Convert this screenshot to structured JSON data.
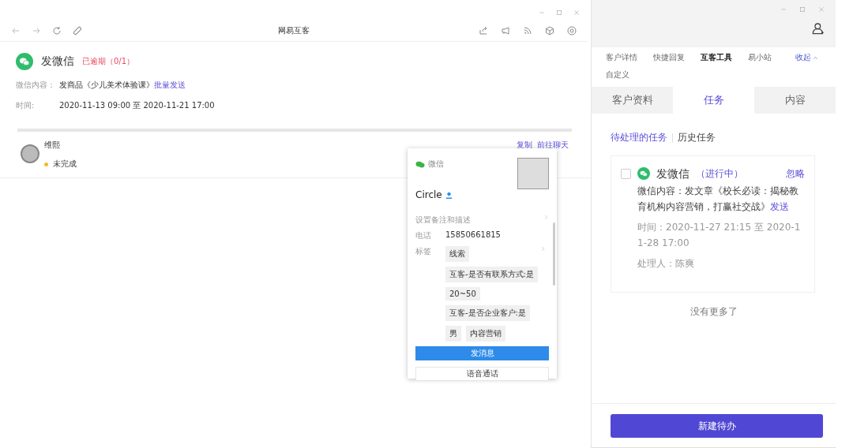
{
  "browser": {
    "title": "网易互客"
  },
  "task": {
    "title": "发微信",
    "status": "已逾期（0/1）",
    "content_label": "微信内容：",
    "content": "发商品《少儿美术体验课》",
    "content_link": "批量发送",
    "time_label": "时间:",
    "time": "2020-11-13 09:00 至 2020-11-21 17:00"
  },
  "assignees": [
    {
      "name": "维熙",
      "status": "未完成",
      "color": "#f5b82e",
      "links": [
        "复制",
        "前往聊天"
      ]
    }
  ],
  "contact_card": {
    "app": "微信",
    "name": "Circle",
    "remark": "设置备注和描述",
    "phone_label": "电话",
    "phone": "15850661815",
    "tags_label": "标签",
    "tags": [
      "线索",
      "互客-是否有联系方式:是",
      "20~50",
      "互客-是否企业客户:是",
      "男",
      "内容营销"
    ],
    "buttons": [
      {
        "label": "发消息",
        "kind": "primary"
      },
      {
        "label": "语音通话",
        "kind": "secondary"
      }
    ]
  },
  "side_panel": {
    "nav": [
      {
        "label": "客户详情",
        "selected": false
      },
      {
        "label": "快捷回复",
        "selected": false
      },
      {
        "label": "互客工具",
        "selected": true
      },
      {
        "label": "易小站",
        "selected": false
      },
      {
        "label": "自定义",
        "selected": false
      }
    ],
    "collapse": "收起",
    "subtabs": [
      {
        "label": "客户资料",
        "selected": false
      },
      {
        "label": "任务",
        "selected": true
      },
      {
        "label": "内容",
        "selected": false
      }
    ],
    "filters": [
      {
        "label": "待处理的任务",
        "selected": true
      },
      {
        "label": "历史任务",
        "selected": false
      }
    ],
    "tasks": [
      {
        "checked": false,
        "title": "发微信",
        "status": "（进行中）",
        "ignore": "忽略",
        "content": "微信内容：发文章《校长必读：揭秘教育机构内容营销，打赢社交战》",
        "send": "发送",
        "time": "时间：2020-11-27 21:15 至 2020-11-28 17:00",
        "handler": "处理人：陈爽"
      }
    ],
    "end_note": "没有更多了",
    "new_button": "新建待办"
  }
}
